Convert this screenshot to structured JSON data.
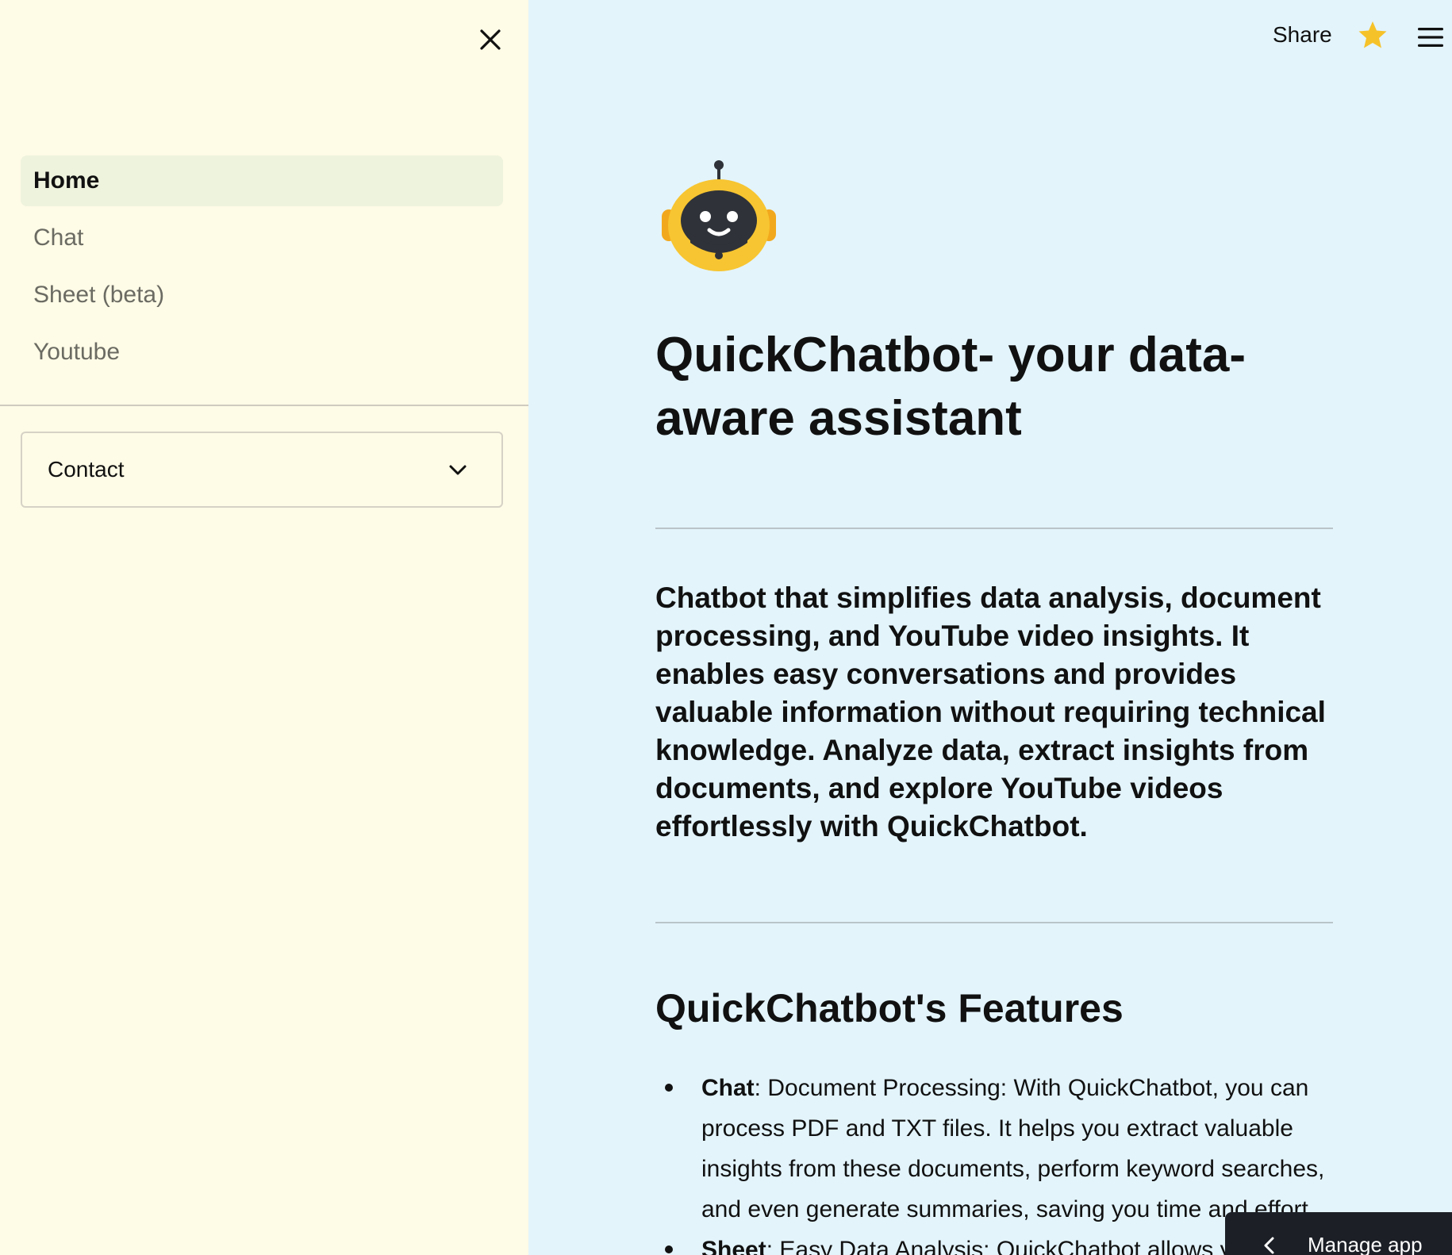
{
  "sidebar": {
    "nav_items": [
      {
        "label": "Home",
        "active": true
      },
      {
        "label": "Chat",
        "active": false
      },
      {
        "label": "Sheet (beta)",
        "active": false
      },
      {
        "label": "Youtube",
        "active": false
      }
    ],
    "contact_label": "Contact",
    "close_icon": "close-icon",
    "background": "#fefbe6",
    "active_background": "#eef3dd"
  },
  "toolbar": {
    "share_label": "Share",
    "star_icon": "star-icon",
    "menu_icon": "hamburger-menu-icon",
    "star_color": "#f6c229"
  },
  "main": {
    "background": "#e3f4fb",
    "logo_icon": "robot-icon",
    "title": "QuickChatbot- your data-aware assistant",
    "intro": "Chatbot that simplifies data analysis, document processing, and YouTube video insights. It enables easy conversations and provides valuable information without requiring technical knowledge. Analyze data, extract insights from documents, and explore YouTube videos effortlessly with QuickChatbot.",
    "features_title": "QuickChatbot's Features",
    "features": [
      {
        "name": "Chat",
        "text": ": Document Processing: With QuickChatbot, you can process PDF and TXT files. It helps you extract valuable insights from these documents, perform keyword searches, and even generate summaries, saving you time and effort."
      },
      {
        "name": "Sheet",
        "text": ": Easy Data Analysis: QuickChatbot allows you"
      }
    ]
  },
  "manage_app": {
    "label": "Manage app",
    "icon": "chevron-left-icon"
  }
}
